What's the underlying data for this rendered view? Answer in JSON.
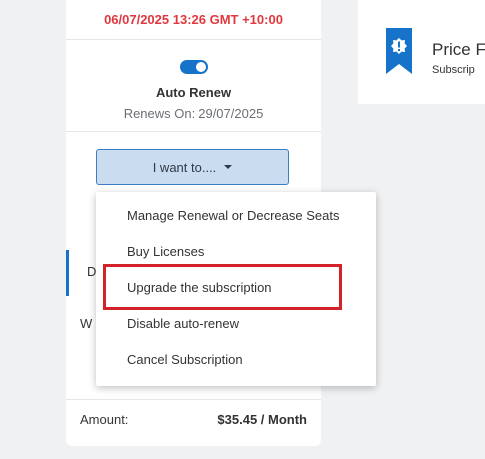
{
  "subscription_card": {
    "datetime": "06/07/2025 13:26 GMT +10:00",
    "auto_renew": {
      "title": "Auto Renew",
      "enabled": true,
      "renews_on_label": "Renews On:",
      "renews_on_date": "29/07/2025"
    },
    "actions_button_label": "I want to....",
    "tab_partial_label": "D",
    "row_partial_label": "W",
    "amount": {
      "label": "Amount:",
      "value": "$35.45 / Month"
    }
  },
  "price_card": {
    "title": "Price F",
    "subtitle": "Subscrip",
    "icon": "ribbon-alert-icon"
  },
  "dropdown_menu": {
    "items": [
      "Manage Renewal or Decrease Seats",
      "Buy Licenses",
      "Upgrade the subscription",
      "Disable auto-renew",
      "Cancel Subscription"
    ],
    "highlighted_index": 2
  },
  "colors": {
    "accent_blue": "#1673c9",
    "date_red": "#e0383e",
    "highlight_red": "#d3222a",
    "button_bg": "#c9dcf0"
  }
}
